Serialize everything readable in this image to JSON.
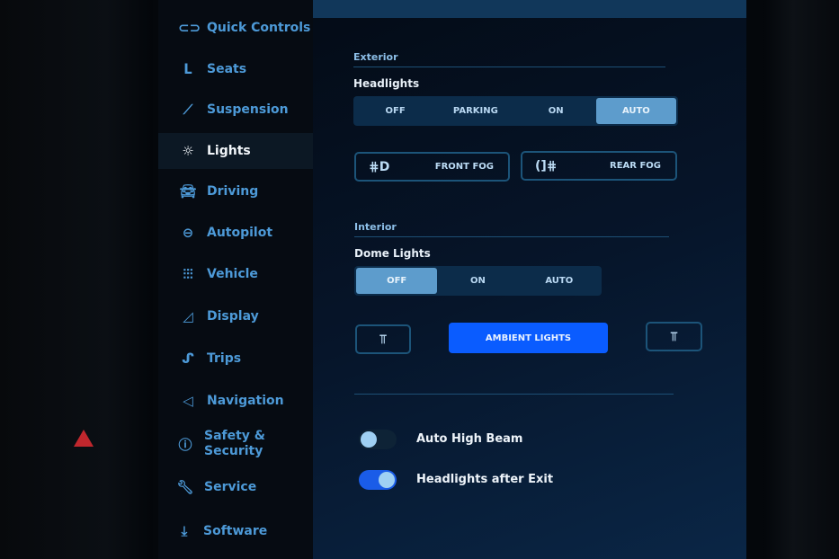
{
  "sidebar": {
    "items": [
      {
        "label": "Quick Controls",
        "icon": "toggle-icon"
      },
      {
        "label": "Seats",
        "icon": "seat-icon"
      },
      {
        "label": "Suspension",
        "icon": "shock-absorber-icon"
      },
      {
        "label": "Lights",
        "icon": "sun-icon",
        "selected": true
      },
      {
        "label": "Driving",
        "icon": "car-icon"
      },
      {
        "label": "Autopilot",
        "icon": "steering-wheel-icon"
      },
      {
        "label": "Vehicle",
        "icon": "sliders-icon"
      },
      {
        "label": "Display",
        "icon": "display-icon"
      },
      {
        "label": "Trips",
        "icon": "route-icon"
      },
      {
        "label": "Navigation",
        "icon": "navigation-arrow-icon"
      },
      {
        "label": "Safety & Security",
        "icon": "alert-circle-icon"
      },
      {
        "label": "Service",
        "icon": "wrench-icon"
      },
      {
        "label": "Software",
        "icon": "download-icon"
      }
    ]
  },
  "exterior": {
    "section": "Exterior",
    "headlights_label": "Headlights",
    "headlights_options": [
      "OFF",
      "PARKING",
      "ON",
      "AUTO"
    ],
    "headlights_selected": "AUTO",
    "front_fog": "FRONT FOG",
    "rear_fog": "REAR FOG"
  },
  "interior": {
    "section": "Interior",
    "dome_label": "Dome Lights",
    "dome_options": [
      "OFF",
      "ON",
      "AUTO"
    ],
    "dome_selected": "OFF",
    "ambient": "AMBIENT LIGHTS"
  },
  "toggles": [
    {
      "label": "Auto High Beam",
      "on": false
    },
    {
      "label": "Headlights after Exit",
      "on": true
    }
  ],
  "colors": {
    "accent": "#0a5cff",
    "nav_text": "#4d9ad8",
    "selected_segment": "#5d9ccc"
  }
}
